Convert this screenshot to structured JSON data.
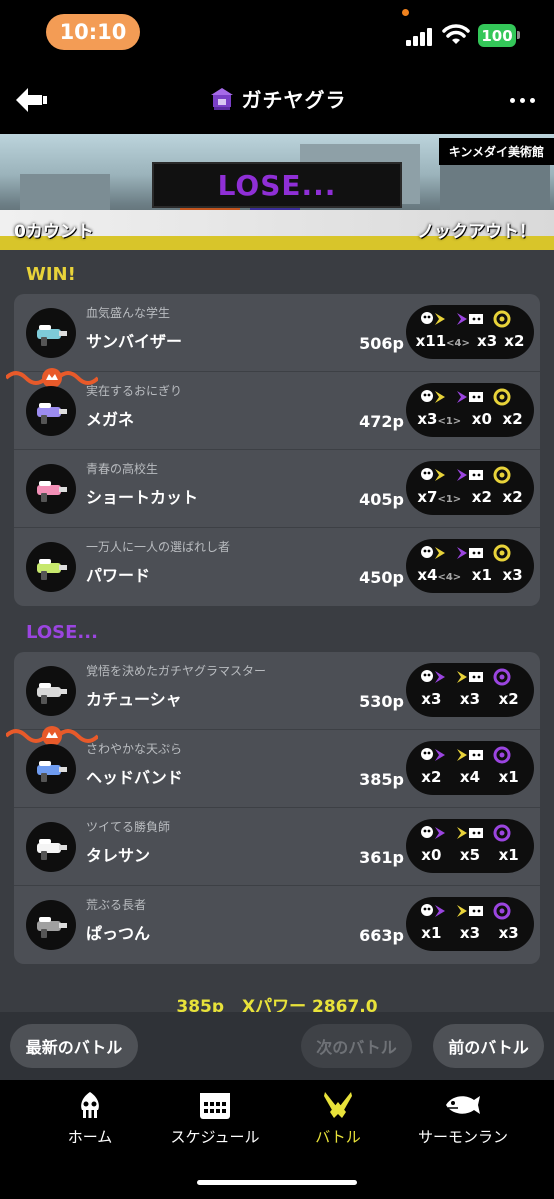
{
  "status": {
    "time": "10:10",
    "battery": "100"
  },
  "header": {
    "title": "ガチヤグラ",
    "back_icon": "back-arrow-icon",
    "more_icon": "more-dots-icon"
  },
  "banner": {
    "stage": "キンメダイ美術館",
    "result": "LOSE...",
    "left_count": "0カウント",
    "right_status": "ノックアウト！"
  },
  "win_label": "WIN!",
  "lose_label": "LOSE...",
  "win_team": [
    {
      "nickname": "血気盛んな学生",
      "name": "サンバイザー",
      "power": "506p",
      "kills": "x11",
      "assists": "<4>",
      "deaths": "x3",
      "specials": "x2",
      "crown": false
    },
    {
      "nickname": "実在するおにぎり",
      "name": "メガネ",
      "power": "472p",
      "kills": "x3",
      "assists": "<1>",
      "deaths": "x0",
      "specials": "x2",
      "crown": true
    },
    {
      "nickname": "青春の高校生",
      "name": "ショートカット",
      "power": "405p",
      "kills": "x7",
      "assists": "<1>",
      "deaths": "x2",
      "specials": "x2",
      "crown": false
    },
    {
      "nickname": "一万人に一人の選ばれし者",
      "name": "パワード",
      "power": "450p",
      "kills": "x4",
      "assists": "<4>",
      "deaths": "x1",
      "specials": "x3",
      "crown": false
    }
  ],
  "lose_team": [
    {
      "nickname": "覚悟を決めたガチヤグラマスター",
      "name": "カチューシャ",
      "power": "530p",
      "kills": "x3",
      "assists": "",
      "deaths": "x3",
      "specials": "x2",
      "crown": false
    },
    {
      "nickname": "さわやかな天ぷら",
      "name": "ヘッドバンド",
      "power": "385p",
      "kills": "x2",
      "assists": "",
      "deaths": "x4",
      "specials": "x1",
      "crown": true
    },
    {
      "nickname": "ツイてる勝負師",
      "name": "タレサン",
      "power": "361p",
      "kills": "x0",
      "assists": "",
      "deaths": "x5",
      "specials": "x1",
      "crown": false
    },
    {
      "nickname": "荒ぶる長者",
      "name": "ぱっつん",
      "power": "663p",
      "kills": "x1",
      "assists": "",
      "deaths": "x3",
      "specials": "x3",
      "crown": false
    }
  ],
  "summary": {
    "my_power": "385p",
    "x_power": "Xパワー 2867.0"
  },
  "buttons": {
    "latest": "最新のバトル",
    "next": "次のバトル",
    "prev": "前のバトル"
  },
  "tabs": [
    {
      "label": "ホーム",
      "icon": "squid-icon"
    },
    {
      "label": "スケジュール",
      "icon": "calendar-icon"
    },
    {
      "label": "バトル",
      "icon": "battle-icon"
    },
    {
      "label": "サーモンラン",
      "icon": "salmon-icon"
    }
  ],
  "colors": {
    "win": "#e8d33a",
    "lose": "#9b45e0",
    "active_tab": "#e8e23a"
  }
}
